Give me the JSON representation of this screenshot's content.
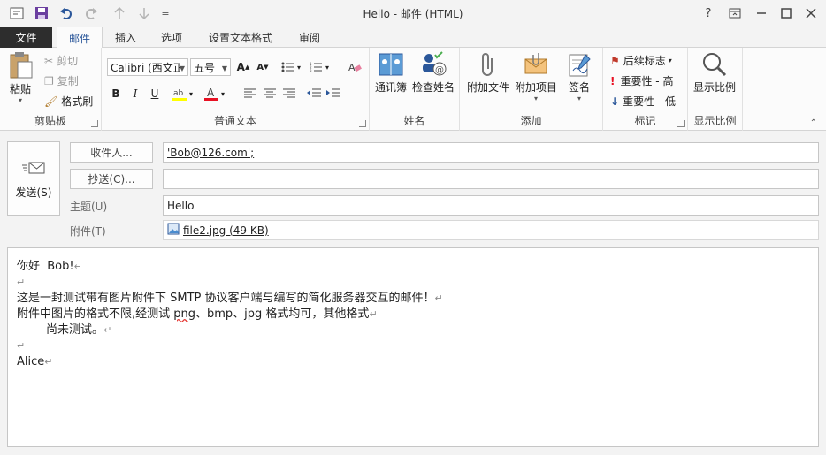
{
  "window": {
    "title": "Hello - 邮件 (HTML)",
    "help": "?",
    "buttons": [
      "restore-ribbon",
      "minimize",
      "maximize",
      "close"
    ]
  },
  "quick_access": {
    "more": "="
  },
  "tabs": {
    "file": "文件",
    "items": [
      "邮件",
      "插入",
      "选项",
      "设置文本格式",
      "审阅"
    ],
    "active": "邮件"
  },
  "ribbon": {
    "clipboard": {
      "label": "剪贴板",
      "paste": "粘贴",
      "cut": "剪切",
      "copy": "复制",
      "format_painter": "格式刷"
    },
    "font": {
      "label": "普通文本",
      "font_name": "Calibri (西文正",
      "font_size": "五号",
      "bold": "B",
      "italic": "I",
      "underline": "U"
    },
    "names": {
      "label": "姓名",
      "address_book": "通讯簿",
      "check_names": "检查姓名"
    },
    "include": {
      "label": "添加",
      "attach_file": "附加文件",
      "attach_item": "附加项目",
      "signature": "签名"
    },
    "tags": {
      "label": "标记",
      "follow_up": "后续标志",
      "high_importance": "重要性 - 高",
      "low_importance": "重要性 - 低"
    },
    "zoom": {
      "label": "显示比例",
      "zoom": "显示比例"
    }
  },
  "header": {
    "send": "发送(S)",
    "to_button": "收件人...",
    "cc_button": "抄送(C)...",
    "to_value": "'Bob@126.com';",
    "cc_value": "",
    "subject_label": "主题(U)",
    "subject_value": "Hello",
    "attachment_label": "附件(T)",
    "attachment_name": "file2.jpg (49 KB)"
  },
  "body": {
    "lines": [
      "你好  Bob!",
      "",
      "这是一封测试带有图片附件下 SMTP 协议客户端与编写的简化服务器交互的邮件！",
      "附件中图片的格式不限,经测试 ",
      "        尚未测试。",
      "",
      "Alice"
    ],
    "line4_png": "png",
    "line4_rest": "、bmp、jpg 格式均可，其他格式",
    "paragraph_mark": "↵"
  },
  "colors": {
    "accent": "#2b579a",
    "file_tab": "#2d2d2d",
    "highlight": "#ffff00",
    "font_color": "#e81123"
  }
}
